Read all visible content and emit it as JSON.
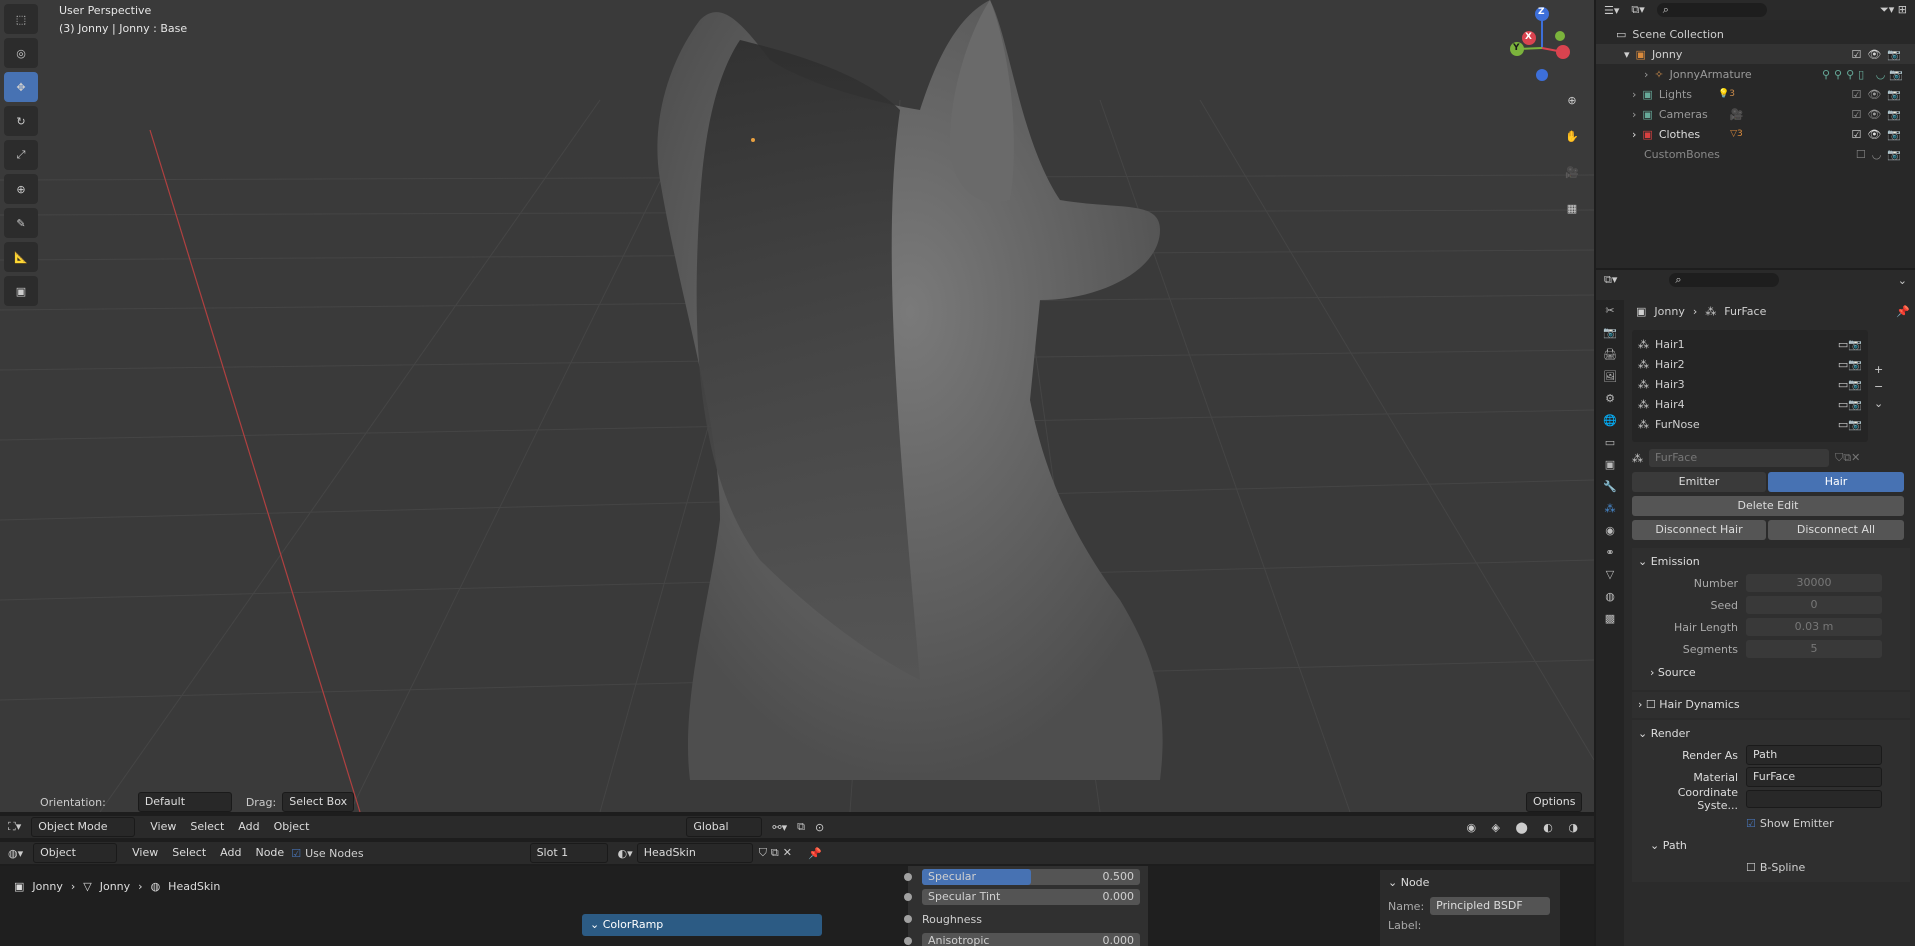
{
  "viewport": {
    "perspective_label": "User Perspective",
    "object_label": "(3) Jonny | Jonny : Base",
    "orientation_label": "Orientation:",
    "orientation_value": "Default",
    "drag_label": "Drag:",
    "drag_value": "Select Box",
    "options_label": "Options",
    "mode": "Object Mode",
    "menus": [
      "View",
      "Select",
      "Add",
      "Object"
    ],
    "transform_space": "Global",
    "axis_labels": {
      "z": "Z",
      "y": "Y",
      "x": "X"
    }
  },
  "node_editor": {
    "type": "Object",
    "menus": [
      "View",
      "Select",
      "Add",
      "Node"
    ],
    "use_nodes_label": "Use Nodes",
    "slot": "Slot 1",
    "material": "HeadSkin",
    "breadcrumb": [
      "Jonny",
      "Jonny",
      "HeadSkin"
    ],
    "colorramp_label": "ColorRamp",
    "sockets": [
      {
        "label": "Specular",
        "value": "0.500"
      },
      {
        "label": "Specular Tint",
        "value": "0.000"
      },
      {
        "label": "Roughness",
        "value": ""
      },
      {
        "label": "Anisotropic",
        "value": "0.000"
      }
    ],
    "node_panel": {
      "title": "Node",
      "name_label": "Name:",
      "name_value": "Principled BSDF",
      "label_label": "Label:"
    }
  },
  "outliner": {
    "title": "Scene Collection",
    "items": [
      {
        "label": "Jonny",
        "color": "#d98a3c"
      },
      {
        "label": "JonnyArmature",
        "color": "#999"
      },
      {
        "label": "Lights",
        "color": "#999"
      },
      {
        "label": "Cameras",
        "color": "#999"
      },
      {
        "label": "Clothes",
        "color": "#ddd"
      },
      {
        "label": "CustomBones",
        "color": "#888"
      }
    ],
    "lights_count": "3",
    "clothes_count": "3"
  },
  "properties": {
    "breadcrumb_object": "Jonny",
    "breadcrumb_system": "FurFace",
    "particle_systems": [
      "Hair1",
      "Hair2",
      "Hair3",
      "Hair4",
      "FurNose"
    ],
    "settings_name": "FurFace",
    "type_tabs": [
      "Emitter",
      "Hair"
    ],
    "delete_edit": "Delete Edit",
    "disconnect_hair": "Disconnect Hair",
    "disconnect_all": "Disconnect All",
    "emission": {
      "title": "Emission",
      "fields": [
        {
          "label": "Number",
          "value": "30000"
        },
        {
          "label": "Seed",
          "value": "0"
        },
        {
          "label": "Hair Length",
          "value": "0.03 m"
        },
        {
          "label": "Segments",
          "value": "5"
        }
      ],
      "source": "Source"
    },
    "hair_dynamics": "Hair Dynamics",
    "render": {
      "title": "Render",
      "render_as_label": "Render As",
      "render_as_value": "Path",
      "material_label": "Material",
      "material_value": "FurFace",
      "coord_label": "Coordinate Syste...",
      "show_emitter": "Show Emitter",
      "path": "Path",
      "bspline": "B-Spline"
    }
  },
  "colors": {
    "accent": "#4772b3",
    "viewport_bg": "#3a3a3a"
  }
}
